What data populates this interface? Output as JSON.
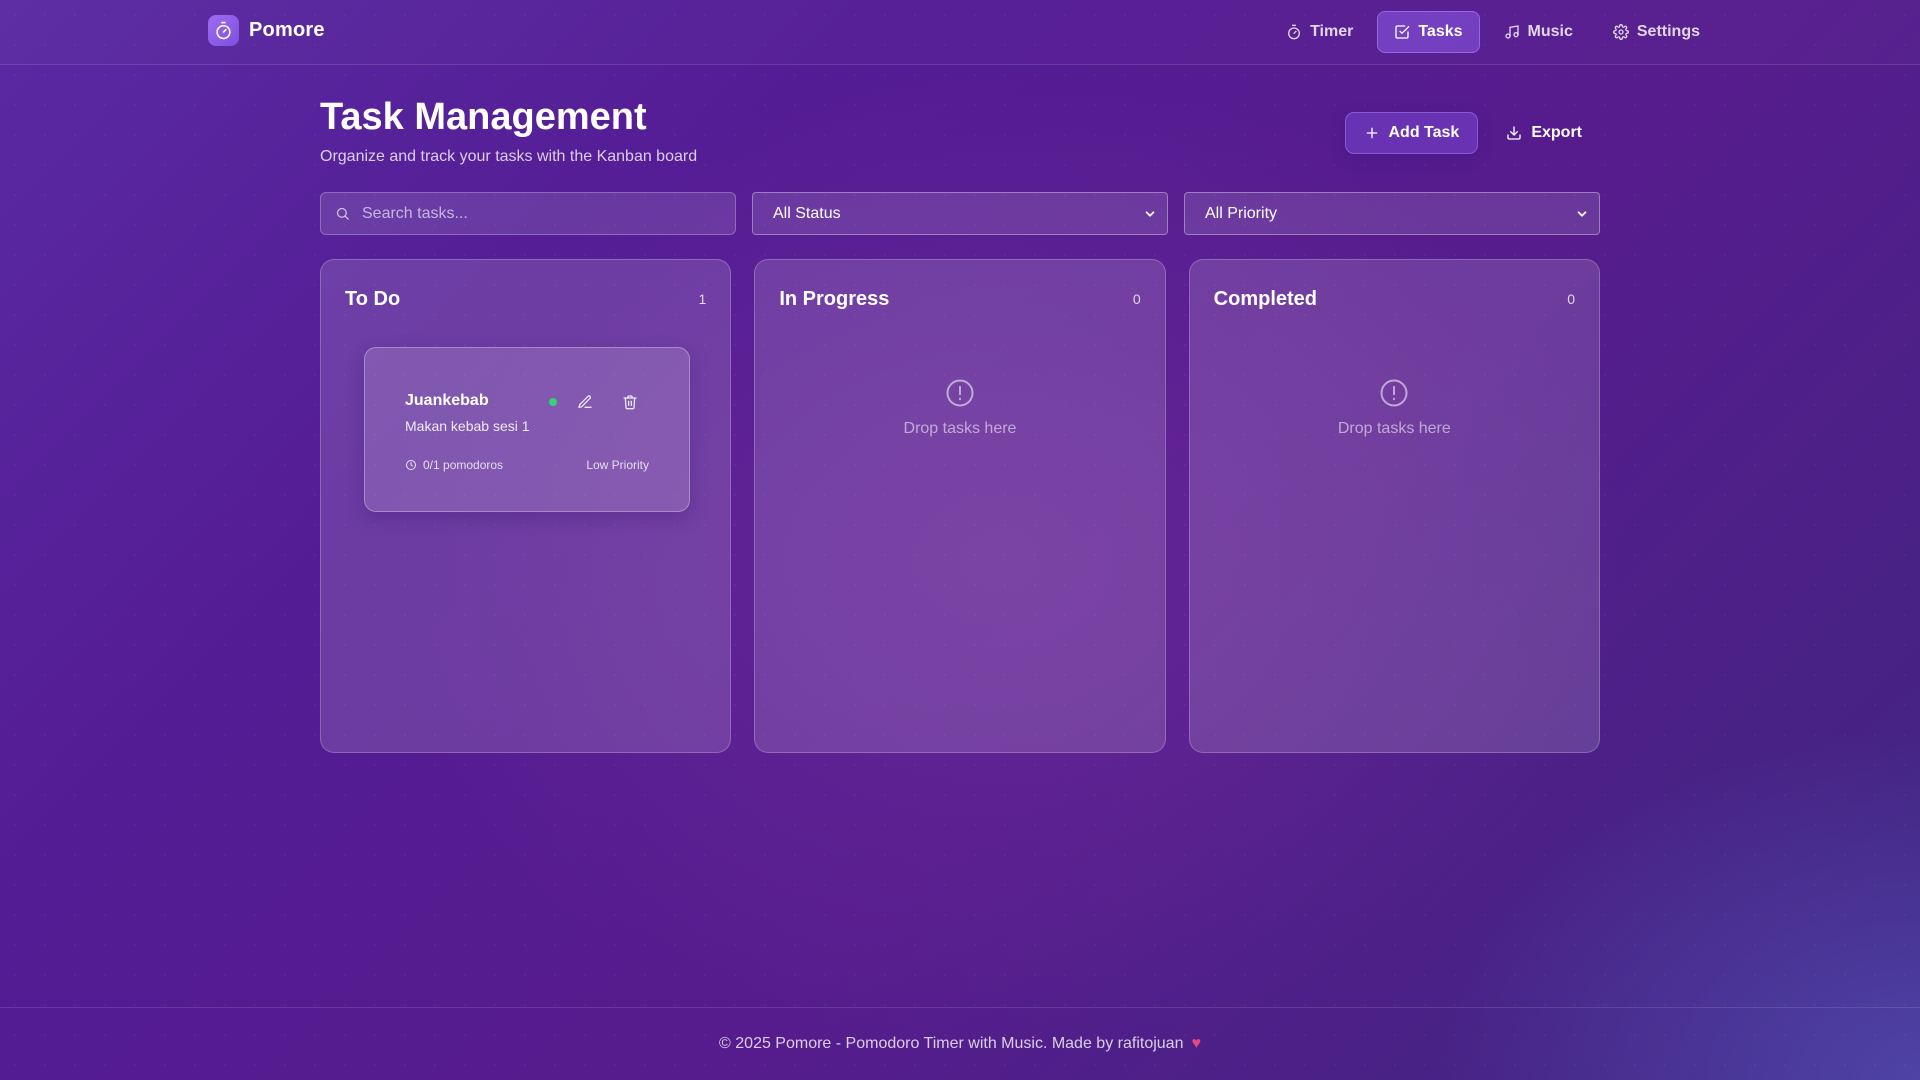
{
  "app": {
    "name": "Pomore"
  },
  "nav": {
    "timer": "Timer",
    "tasks": "Tasks",
    "music": "Music",
    "settings": "Settings",
    "active": "Tasks"
  },
  "page": {
    "title": "Task Management",
    "subtitle": "Organize and track your tasks with the Kanban board",
    "add_task": "Add Task",
    "export": "Export"
  },
  "filters": {
    "search_placeholder": "Search tasks...",
    "search_value": "",
    "status_selected": "All Status",
    "priority_selected": "All Priority"
  },
  "columns": [
    {
      "title": "To Do",
      "count": "1",
      "tasks": [
        {
          "title": "Juankebab",
          "description": "Makan kebab sesi 1",
          "pomodoros": "0/1 pomodoros",
          "priority": "Low Priority",
          "status_color": "#34d07a"
        }
      ]
    },
    {
      "title": "In Progress",
      "count": "0",
      "empty_text": "Drop tasks here",
      "tasks": []
    },
    {
      "title": "Completed",
      "count": "0",
      "empty_text": "Drop tasks here",
      "tasks": []
    }
  ],
  "footer": {
    "text": "© 2025 Pomore - Pomodoro Timer with Music. Made by rafitojuan",
    "heart_icon": "heart-icon"
  },
  "colors": {
    "accent": "#8c5ae6",
    "status_dot": "#34d07a",
    "heart": "#e34a84"
  }
}
